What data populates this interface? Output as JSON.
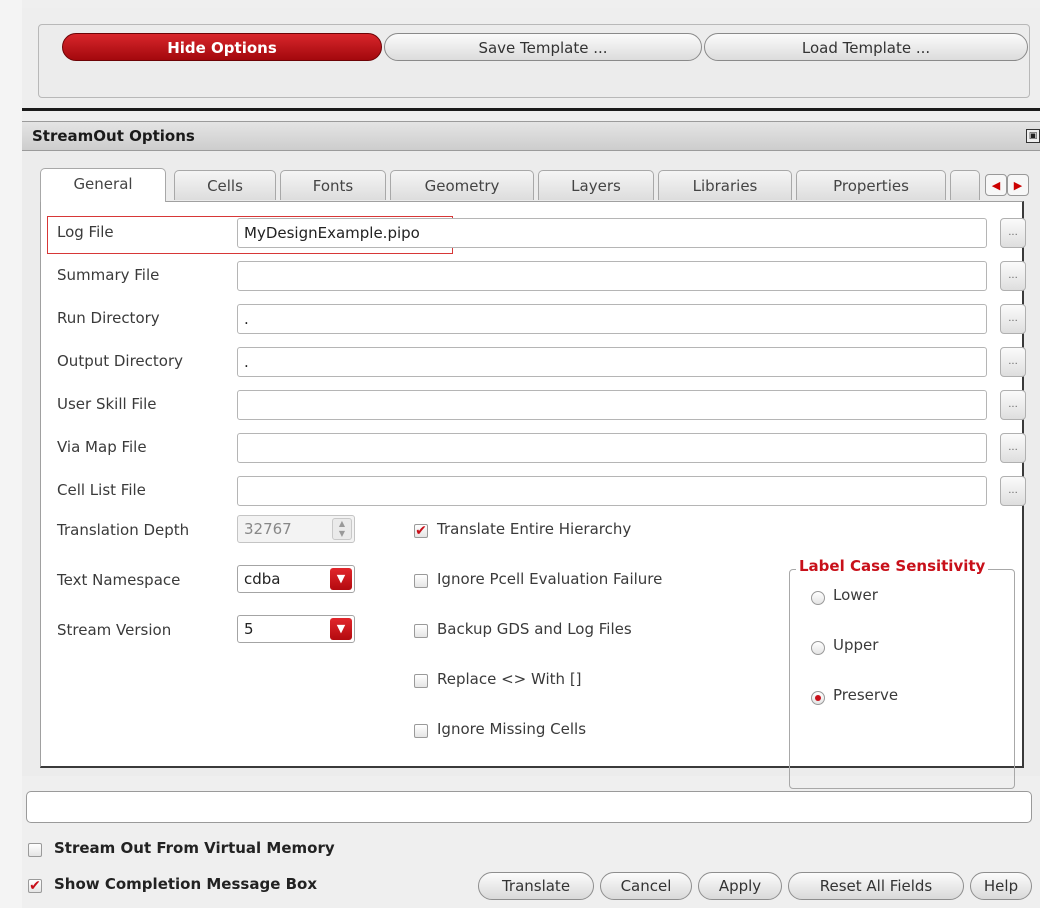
{
  "toolbar": {
    "hide_options": "Hide Options",
    "save_template": "Save Template ...",
    "load_template": "Load Template ..."
  },
  "options_panel": {
    "title": "StreamOut Options"
  },
  "tabs": [
    {
      "label": "General",
      "active": true
    },
    {
      "label": "Cells"
    },
    {
      "label": "Fonts"
    },
    {
      "label": "Geometry"
    },
    {
      "label": "Layers"
    },
    {
      "label": "Libraries"
    },
    {
      "label": "Properties"
    }
  ],
  "fields": [
    {
      "label": "Log File",
      "value": "MyDesignExample.pipo"
    },
    {
      "label": "Summary File",
      "value": ""
    },
    {
      "label": "Run Directory",
      "value": "."
    },
    {
      "label": "Output Directory",
      "value": "."
    },
    {
      "label": "User Skill File",
      "value": ""
    },
    {
      "label": "Via Map File",
      "value": ""
    },
    {
      "label": "Cell List File",
      "value": ""
    }
  ],
  "browse_label": "...",
  "translation_depth": {
    "label": "Translation Depth",
    "value": "32767"
  },
  "text_namespace": {
    "label": "Text Namespace",
    "value": "cdba"
  },
  "stream_version": {
    "label": "Stream Version",
    "value": "5"
  },
  "checkboxes": [
    {
      "label": "Translate Entire Hierarchy",
      "checked": true
    },
    {
      "label": "Ignore Pcell Evaluation Failure",
      "checked": false
    },
    {
      "label": "Backup GDS and Log Files",
      "checked": false
    },
    {
      "label": "Replace <> With []",
      "checked": false
    },
    {
      "label": "Ignore Missing Cells",
      "checked": false
    }
  ],
  "label_case": {
    "title": "Label Case Sensitivity",
    "options": [
      "Lower",
      "Upper",
      "Preserve"
    ],
    "selected": "Preserve"
  },
  "status_text": "",
  "bottom_options": [
    {
      "label": "Stream Out From Virtual Memory",
      "checked": false
    },
    {
      "label": "Show Completion Message Box",
      "checked": true
    }
  ],
  "buttons": {
    "translate": "Translate",
    "cancel": "Cancel",
    "apply": "Apply",
    "reset": "Reset All Fields",
    "help": "Help"
  },
  "colors": {
    "accent": "#c8101a",
    "panel_bg": "#efefef"
  }
}
